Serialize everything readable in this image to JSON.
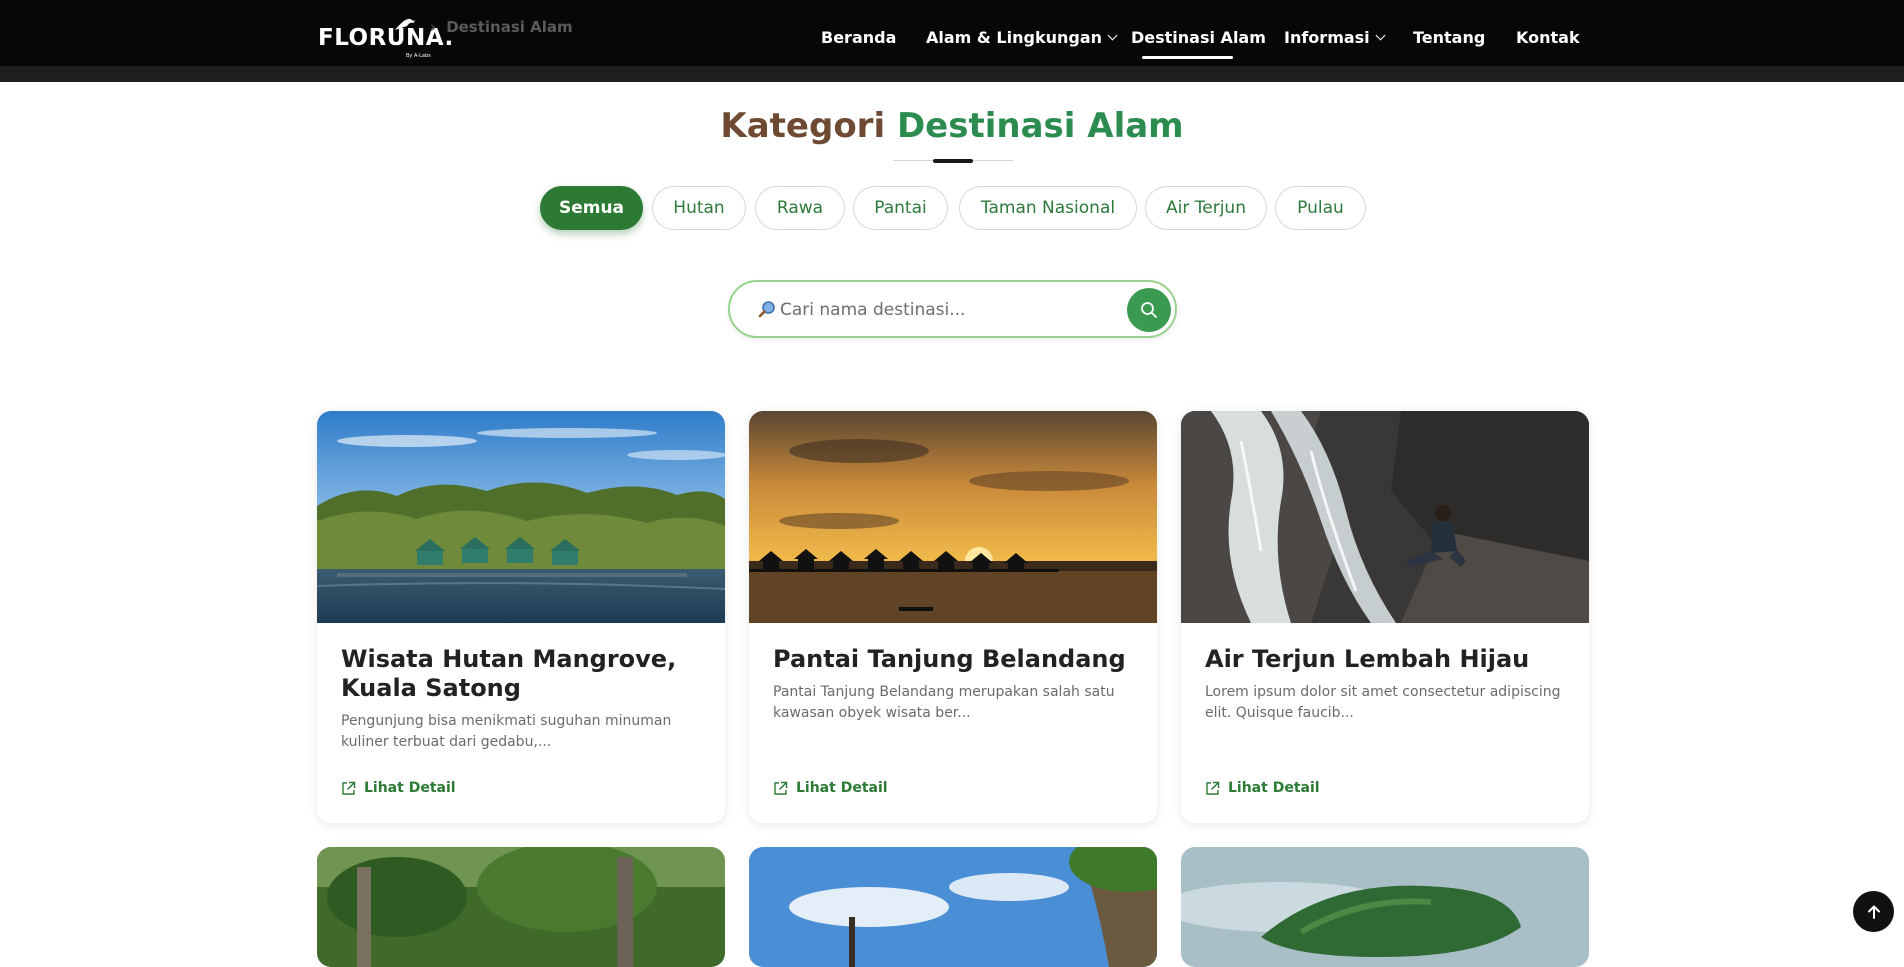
{
  "brand": {
    "name": "FLORUNA.",
    "tagline": "By A-Labs"
  },
  "breadcrumb": {
    "current": "Destinasi Alam"
  },
  "nav": {
    "items": [
      {
        "label": "Beranda"
      },
      {
        "label": "Alam & Lingkungan",
        "dropdown": true
      },
      {
        "label": "Destinasi Alam",
        "active": true
      },
      {
        "label": "Informasi",
        "dropdown": true
      },
      {
        "label": "Tentang"
      },
      {
        "label": "Kontak"
      }
    ]
  },
  "section": {
    "title_part1": "Kategori",
    "title_part2": "Destinasi Alam"
  },
  "filters": {
    "selected": "Semua",
    "items": [
      "Semua",
      "Hutan",
      "Rawa",
      "Pantai",
      "Taman Nasional",
      "Air Terjun",
      "Pulau"
    ]
  },
  "search": {
    "placeholder": "Cari nama destinasi...",
    "value": ""
  },
  "cards": [
    {
      "title": "Wisata Hutan Mangrove, Kuala Satong",
      "description": "Pengunjung bisa menikmati suguhan minuman kuliner terbuat dari gedabu,...",
      "link_label": "Lihat Detail",
      "image": "mangrove-forest-photo"
    },
    {
      "title": "Pantai Tanjung Belandang",
      "description": "Pantai Tanjung Belandang merupakan salah satu kawasan obyek wisata ber...",
      "link_label": "Lihat Detail",
      "image": "sunset-beach-photo"
    },
    {
      "title": "Air Terjun Lembah Hijau",
      "description": "Lorem ipsum dolor sit amet consectetur adipiscing elit. Quisque faucib...",
      "link_label": "Lihat Detail",
      "image": "waterfall-photo"
    }
  ],
  "colors": {
    "brand_green": "#2d7a35",
    "title_brown": "#6e4a33",
    "title_green": "#2c8c4f",
    "header_bg": "#070707"
  },
  "icons": {
    "search": "magnifier-icon",
    "external_link": "external-link-icon",
    "back_to_top": "arrow-up-icon"
  }
}
